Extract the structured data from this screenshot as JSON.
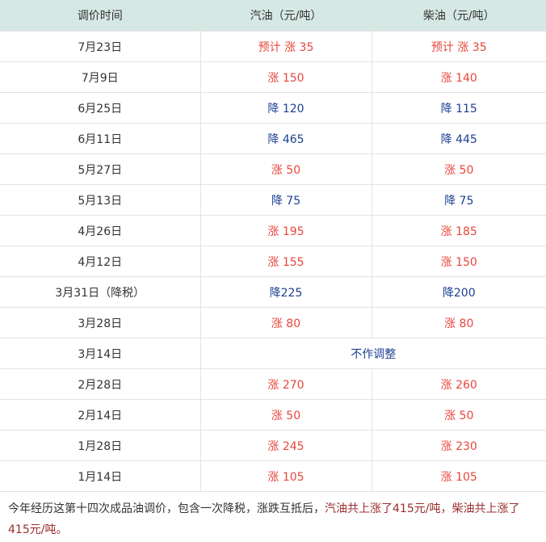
{
  "table": {
    "headers": [
      "调价时间",
      "汽油（元/吨）",
      "柴油（元/吨）"
    ],
    "rows": [
      {
        "date": "7月23日",
        "gasoline": "预计 涨 35",
        "diesel": "预计 涨 35",
        "kind": "up"
      },
      {
        "date": "7月9日",
        "gasoline": "涨 150",
        "diesel": "涨 140",
        "kind": "up"
      },
      {
        "date": "6月25日",
        "gasoline": "降 120",
        "diesel": "降 115",
        "kind": "down"
      },
      {
        "date": "6月11日",
        "gasoline": "降 465",
        "diesel": "降 445",
        "kind": "down"
      },
      {
        "date": "5月27日",
        "gasoline": "涨 50",
        "diesel": "涨 50",
        "kind": "up"
      },
      {
        "date": "5月13日",
        "gasoline": "降 75",
        "diesel": "降 75",
        "kind": "down"
      },
      {
        "date": "4月26日",
        "gasoline": "涨 195",
        "diesel": "涨 185",
        "kind": "up"
      },
      {
        "date": "4月12日",
        "gasoline": "涨 155",
        "diesel": "涨 150",
        "kind": "up"
      },
      {
        "date": "3月31日（降税）",
        "gasoline": "降225",
        "diesel": "降200",
        "kind": "down"
      },
      {
        "date": "3月28日",
        "gasoline": "涨 80",
        "diesel": "涨 80",
        "kind": "up"
      },
      {
        "date": "3月14日",
        "merged": "不作调整",
        "kind": "none"
      },
      {
        "date": "2月28日",
        "gasoline": "涨 270",
        "diesel": "涨 260",
        "kind": "up"
      },
      {
        "date": "2月14日",
        "gasoline": "涨 50",
        "diesel": "涨 50",
        "kind": "up"
      },
      {
        "date": "1月28日",
        "gasoline": "涨 245",
        "diesel": "涨 230",
        "kind": "up"
      },
      {
        "date": "1月14日",
        "gasoline": "涨 105",
        "diesel": "涨 105",
        "kind": "up"
      }
    ]
  },
  "summary": {
    "plain": "今年经历这第十四次成品油调价，包含一次降税，涨跌互抵后，",
    "highlight": "汽油共上涨了415元/吨，柴油共上涨了415元/吨。"
  },
  "colors": {
    "header_bg": "#d6e8e4",
    "up": "#e8453c",
    "down": "#1c3f94",
    "summary_highlight": "#9b2d2d",
    "border": "#e3e3e3"
  }
}
